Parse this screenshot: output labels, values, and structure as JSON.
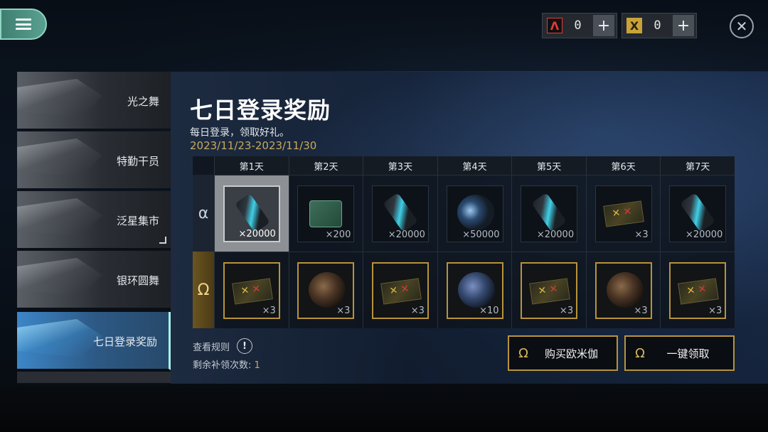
{
  "header": {
    "currency_red": {
      "icon": "red-a-token-icon",
      "value": "0",
      "plus": "+"
    },
    "currency_gold": {
      "icon": "gold-x-token-icon",
      "value": "0",
      "plus": "+"
    },
    "close": "✕"
  },
  "sidebar": {
    "items": [
      {
        "label": "光之舞"
      },
      {
        "label": "特勤干员"
      },
      {
        "label": "泛星集市"
      },
      {
        "label": "银环圆舞"
      },
      {
        "label": "七日登录奖励"
      }
    ]
  },
  "event": {
    "title": "七日登录奖励",
    "subtitle": "每日登录，领取好礼。",
    "date_range": "2023/11/23-2023/11/30"
  },
  "grid": {
    "alpha_symbol": "α",
    "omega_symbol": "Ω",
    "days": [
      "第1天",
      "第2天",
      "第3天",
      "第4天",
      "第5天",
      "第6天",
      "第7天"
    ],
    "alpha_rewards": [
      {
        "icon": "canister",
        "qty": "×20000"
      },
      {
        "icon": "card",
        "qty": "×200"
      },
      {
        "icon": "canister",
        "qty": "×20000"
      },
      {
        "icon": "cylinder",
        "qty": "×50000"
      },
      {
        "icon": "canister",
        "qty": "×20000"
      },
      {
        "icon": "ticket",
        "qty": "×3"
      },
      {
        "icon": "canister",
        "qty": "×20000"
      }
    ],
    "omega_rewards": [
      {
        "icon": "ticket",
        "qty": "×3"
      },
      {
        "icon": "orb",
        "qty": "×3"
      },
      {
        "icon": "ticket",
        "qty": "×3"
      },
      {
        "icon": "orb-blue",
        "qty": "×10"
      },
      {
        "icon": "ticket",
        "qty": "×3"
      },
      {
        "icon": "orb",
        "qty": "×3"
      },
      {
        "icon": "ticket",
        "qty": "×3"
      }
    ]
  },
  "footer": {
    "rules_label": "查看规则",
    "info_glyph": "!",
    "remaining_label": "剩余补领次数: ",
    "remaining_count": "1",
    "buy_button": {
      "symbol": "Ω",
      "label": "购买欧米伽"
    },
    "claim_button": {
      "symbol": "Ω",
      "label": "一键领取"
    }
  },
  "colors": {
    "accent_gold": "#b8933a",
    "accent_teal": "#5aa090",
    "date_gold": "#c8aa5a"
  }
}
